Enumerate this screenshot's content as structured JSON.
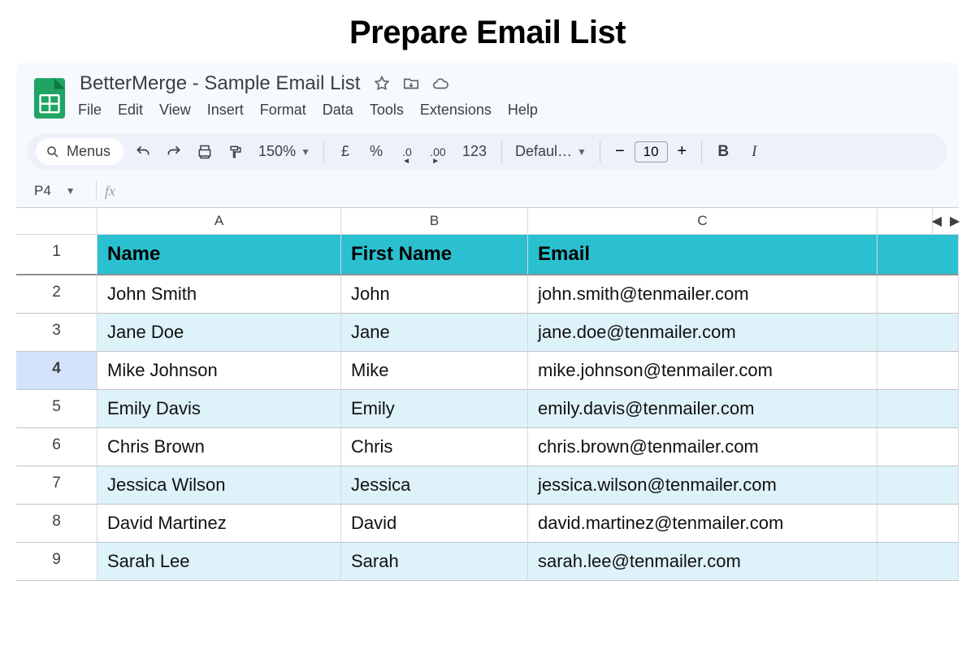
{
  "page_heading": "Prepare Email List",
  "doc": {
    "title": "BetterMerge - Sample Email List"
  },
  "menus": [
    "File",
    "Edit",
    "View",
    "Insert",
    "Format",
    "Data",
    "Tools",
    "Extensions",
    "Help"
  ],
  "toolbar": {
    "menus_label": "Menus",
    "zoom": "150%",
    "currency_symbol": "£",
    "percent_symbol": "%",
    "dec_less": ".0",
    "dec_more": ".00",
    "format_123": "123",
    "font_name": "Defaul…",
    "font_size": "10",
    "bold": "B",
    "italic": "I"
  },
  "name_box": "P4",
  "selected_row_label": "4",
  "columns": [
    "A",
    "B",
    "C"
  ],
  "header_row": {
    "name": "Name",
    "first": "First Name",
    "email": "Email"
  },
  "rows": [
    {
      "n": "2",
      "name": "John Smith",
      "first": "John",
      "email": "john.smith@tenmailer.com",
      "alt": false
    },
    {
      "n": "3",
      "name": "Jane Doe",
      "first": "Jane",
      "email": "jane.doe@tenmailer.com",
      "alt": true
    },
    {
      "n": "4",
      "name": "Mike Johnson",
      "first": "Mike",
      "email": "mike.johnson@tenmailer.com",
      "alt": false
    },
    {
      "n": "5",
      "name": "Emily Davis",
      "first": "Emily",
      "email": "emily.davis@tenmailer.com",
      "alt": true
    },
    {
      "n": "6",
      "name": "Chris Brown",
      "first": "Chris",
      "email": "chris.brown@tenmailer.com",
      "alt": false
    },
    {
      "n": "7",
      "name": "Jessica Wilson",
      "first": "Jessica",
      "email": "jessica.wilson@tenmailer.com",
      "alt": true
    },
    {
      "n": "8",
      "name": "David Martinez",
      "first": "David",
      "email": "david.martinez@tenmailer.com",
      "alt": false
    },
    {
      "n": "9",
      "name": "Sarah Lee",
      "first": "Sarah",
      "email": "sarah.lee@tenmailer.com",
      "alt": true
    }
  ],
  "row_header_1": "1"
}
